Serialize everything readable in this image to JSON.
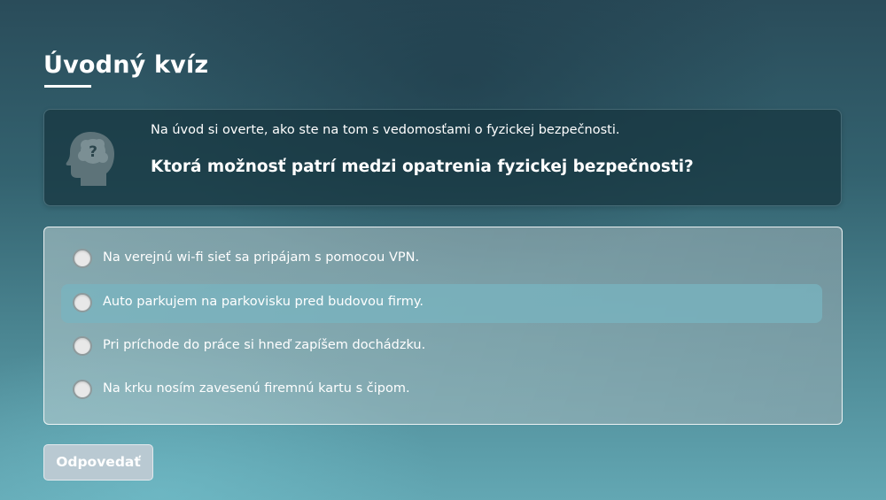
{
  "quiz": {
    "title": "Úvodný kvíz"
  },
  "question_card": {
    "icon": "head-question-icon",
    "intro": "Na úvod si overte, ako ste na tom s vedomosťami o fyzickej bezpečnosti.",
    "question": "Ktorá možnosť patrí medzi opatrenia fyzickej bezpečnosti?"
  },
  "options": [
    {
      "label": "Na verejnú wi-fi sieť sa pripájam s pomocou VPN.",
      "selected": false
    },
    {
      "label": "Auto parkujem na parkovisku pred budovou firmy.",
      "selected": false,
      "hovered": true
    },
    {
      "label": "Pri príchode do práce si hneď zapíšem dochádzku.",
      "selected": false
    },
    {
      "label": "Na krku nosím zavesenú firemnú kartu s čipom.",
      "selected": false
    }
  ],
  "submit": {
    "label": "Odpovedať",
    "enabled": false
  },
  "colors": {
    "background_top": "#2a4c5a",
    "background_bottom": "#63a7b3",
    "card": "#16343e",
    "hover_option": "#78b4c0",
    "button_disabled": "#b9c9d2"
  }
}
